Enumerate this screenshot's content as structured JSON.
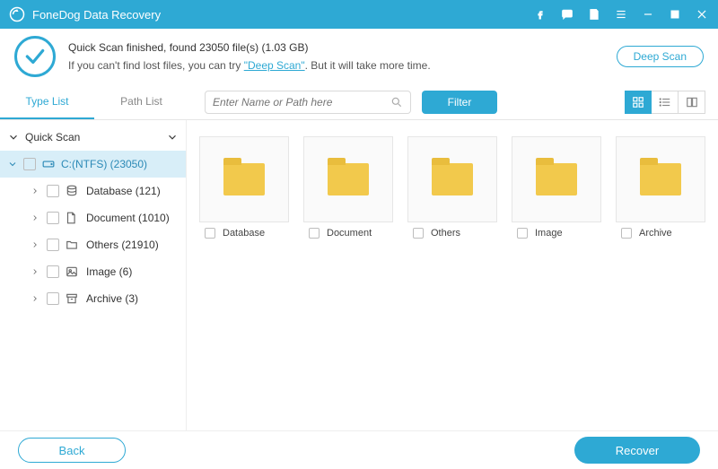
{
  "app": {
    "title": "FoneDog Data Recovery"
  },
  "status": {
    "line1": "Quick Scan finished, found 23050 file(s) (1.03 GB)",
    "line2_pre": "If you can't find lost files, you can try ",
    "line2_link": "\"Deep Scan\"",
    "line2_post": ". But it will take more time."
  },
  "buttons": {
    "deep_scan": "Deep Scan",
    "back": "Back",
    "recover": "Recover",
    "filter": "Filter"
  },
  "tabs": {
    "type_list": "Type List",
    "path_list": "Path List"
  },
  "search": {
    "placeholder": "Enter Name or Path here"
  },
  "tree": {
    "root": "Quick Scan",
    "drive": "C:(NTFS) (23050)",
    "cats": [
      {
        "label": "Database (121)"
      },
      {
        "label": "Document (1010)"
      },
      {
        "label": "Others (21910)"
      },
      {
        "label": "Image (6)"
      },
      {
        "label": "Archive (3)"
      }
    ]
  },
  "folders": [
    {
      "label": "Database"
    },
    {
      "label": "Document"
    },
    {
      "label": "Others"
    },
    {
      "label": "Image"
    },
    {
      "label": "Archive"
    }
  ]
}
